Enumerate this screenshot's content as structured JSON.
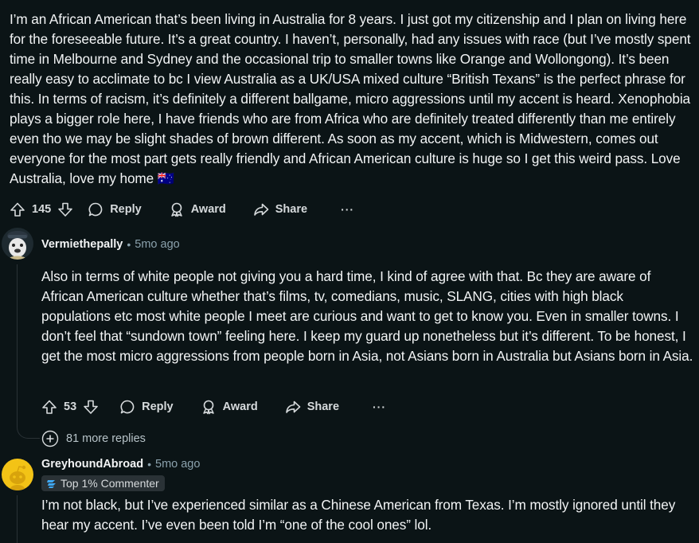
{
  "top_comment": {
    "text": "I’m an African American that’s been living in Australia for 8 years. I just got my citizenship and I plan on living here for the foreseeable future. It’s a great country. I haven’t, personally, had any issues with race (but I’ve mostly spent time in Melbourne and Sydney and the occasional trip to smaller towns like Orange and Wollongong). It’s been really easy to acclimate to bc I view Australia as a UK/USA mixed culture “British Texans” is the perfect phrase for this. In terms of racism, it’s definitely a different ballgame, micro aggressions until my accent is heard. Xenophobia plays a bigger role here, I have friends who are from Africa who are definitely treated differently than me entirely even tho we may be slight shades of brown different. As soon as my accent, which is Midwestern, comes out everyone for the most part gets really friendly and African American culture is huge so I get this weird pass. Love Australia, love my home",
    "flag_emoji": "🇦🇺",
    "votes": "145",
    "reply_label": "Reply",
    "award_label": "Award",
    "share_label": "Share",
    "more_label": "···"
  },
  "reply_1": {
    "author": "Vermiethepally",
    "separator": "•",
    "time": "5mo ago",
    "text": "Also in terms of white people not giving you a hard time, I kind of agree with that. Bc they are aware of African American culture whether that’s films, tv, comedians, music, SLANG, cities with high black populations etc most white people I meet are curious and want to get to know you. Even in smaller towns. I don’t feel that “sundown town” feeling here. I keep my guard up nonetheless but it’s different. To be honest, I get the most micro aggressions from people born in Asia, not Asians born in Australia but Asians born in Asia.",
    "votes": "53",
    "reply_label": "Reply",
    "award_label": "Award",
    "share_label": "Share",
    "more_label": "···"
  },
  "more_replies": {
    "label": "81 more replies"
  },
  "reply_2": {
    "author": "GreyhoundAbroad",
    "separator": "•",
    "time": "5mo ago",
    "badge": "Top 1% Commenter",
    "text": "I’m not black, but I’ve experienced similar as a Chinese American from Texas. I’m mostly ignored until they hear my accent. I’ve even been told I’m “one of the cool ones” lol."
  },
  "colors": {
    "background": "#0b1416",
    "text": "#f2f4f5",
    "muted": "#8ba2ad",
    "thread_line": "#2a3236",
    "avatar_yellow": "#f3c316"
  },
  "icons": [
    "upvote-icon",
    "downvote-icon",
    "comment-icon",
    "award-icon",
    "share-icon",
    "more-icon",
    "expand-plus-icon",
    "commenter-badge-icon"
  ]
}
